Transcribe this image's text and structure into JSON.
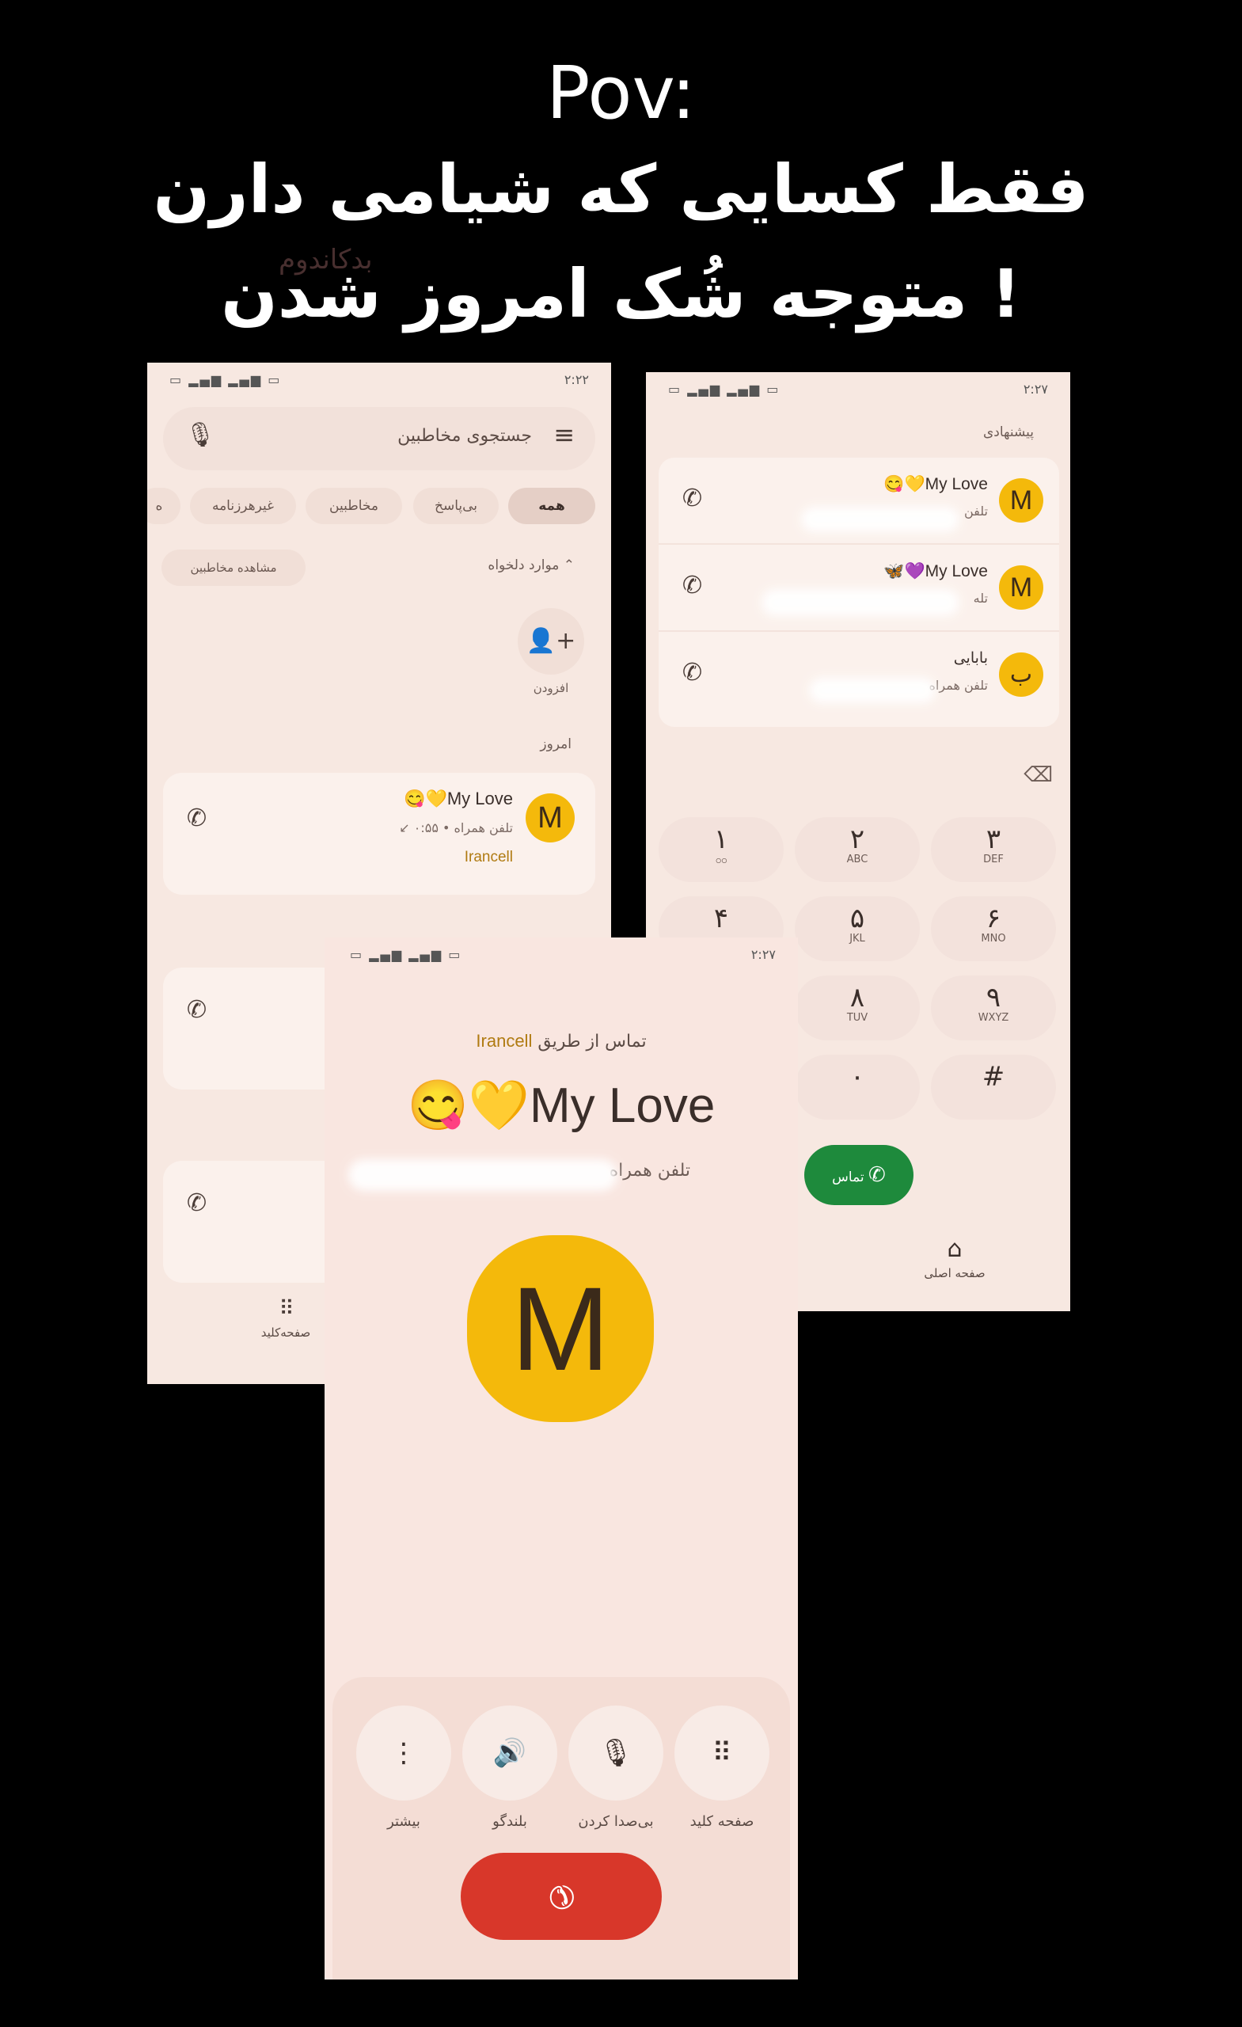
{
  "caption": {
    "line1": "Pov:",
    "line2": "فقط کسایی که شیامی دارن",
    "line3": "متوجه شُک امروز شدن !",
    "watermark": "بدکاندوم"
  },
  "screen_contacts": {
    "status_time": "۲:۲۲",
    "search_placeholder": "جستجوی مخاطبین",
    "tabs": [
      "همه",
      "بی‌پاسخ",
      "مخاطبین",
      "غیرهرزنامه",
      "ه"
    ],
    "favorites_label": "موارد دلخواه",
    "view_contacts": "مشاهده مخاطبین",
    "add_label": "افزودن",
    "today_label": "امروز",
    "call_entry": {
      "avatar": "M",
      "name": "My Love",
      "detail": "۰:۵۵ • تلفن همراه",
      "carrier": "Irancell"
    },
    "keypad_label": "صفحه‌کلید"
  },
  "screen_dialer": {
    "status_time": "۲:۲۷",
    "suggested_label": "پیشنهادی",
    "suggestions": [
      {
        "avatar": "M",
        "name": "My Love",
        "sub": "تلفن"
      },
      {
        "avatar": "M",
        "name": "My Love",
        "sub": "تله"
      },
      {
        "avatar": "ب",
        "name": "بابایی",
        "sub": "تلفن همراه"
      }
    ],
    "keys": [
      {
        "d": "۱",
        "s": "ဝဝ"
      },
      {
        "d": "۲",
        "s": "ABC"
      },
      {
        "d": "۳",
        "s": "DEF"
      },
      {
        "d": "۴",
        "s": ""
      },
      {
        "d": "۵",
        "s": "JKL"
      },
      {
        "d": "۶",
        "s": "MNO"
      },
      {
        "d": "۸",
        "s": "TUV"
      },
      {
        "d": "۹",
        "s": "WXYZ"
      },
      {
        "d": "۰",
        "s": ""
      },
      {
        "d": "#",
        "s": ""
      }
    ],
    "call_button": "تماس",
    "home_label": "صفحه اصلی"
  },
  "screen_incall": {
    "status_time": "۲:۲۷",
    "via_prefix": "تماس از طریق",
    "carrier": "Irancell",
    "name": "My Love",
    "number_label": "تلفن همراه",
    "avatar": "M",
    "actions": [
      "بیشتر",
      "بلندگو",
      "بی‌صدا کردن",
      "صفحه کلید"
    ]
  }
}
